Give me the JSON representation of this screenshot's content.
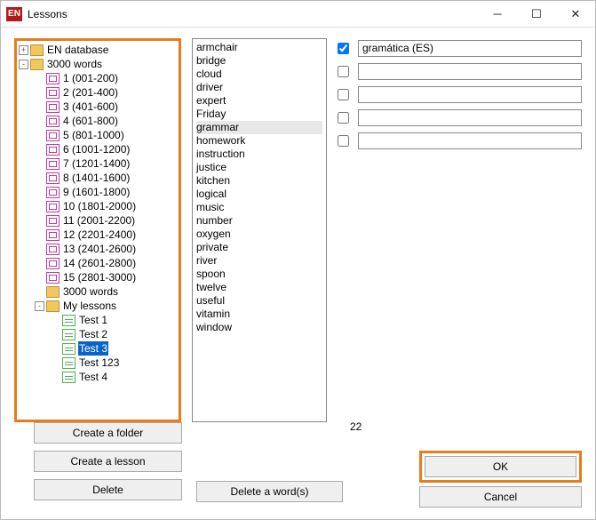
{
  "window": {
    "icon_text": "EN",
    "title": "Lessons"
  },
  "tree": {
    "root1": "EN database",
    "root2": "3000 words",
    "numbered": [
      "1 (001-200)",
      "2 (201-400)",
      "3 (401-600)",
      "4 (601-800)",
      "5 (801-1000)",
      "6 (1001-1200)",
      "7 (1201-1400)",
      "8 (1401-1600)",
      "9 (1601-1800)",
      "10 (1801-2000)",
      "11 (2001-2200)",
      "12 (2201-2400)",
      "13 (2401-2600)",
      "14 (2601-2800)",
      "15 (2801-3000)"
    ],
    "folder_3000": "3000 words",
    "my_lessons": "My lessons",
    "tests": [
      "Test 1",
      "Test 2",
      "Test 3",
      "Test 123",
      "Test 4"
    ],
    "selected": "Test 3"
  },
  "words": [
    "armchair",
    "bridge",
    "cloud",
    "driver",
    "expert",
    "Friday",
    "grammar",
    "homework",
    "instruction",
    "justice",
    "kitchen",
    "logical",
    "music",
    "number",
    "oxygen",
    "private",
    "river",
    "spoon",
    "twelve",
    "useful",
    "vitamin",
    "window"
  ],
  "word_selected": "grammar",
  "fields": [
    {
      "checked": true,
      "value": "gramática (ES)"
    },
    {
      "checked": false,
      "value": ""
    },
    {
      "checked": false,
      "value": ""
    },
    {
      "checked": false,
      "value": ""
    },
    {
      "checked": false,
      "value": ""
    }
  ],
  "count_label": "22",
  "buttons": {
    "create_folder": "Create a folder",
    "create_lesson": "Create a lesson",
    "delete": "Delete",
    "delete_words": "Delete a word(s)",
    "ok": "OK",
    "cancel": "Cancel"
  }
}
